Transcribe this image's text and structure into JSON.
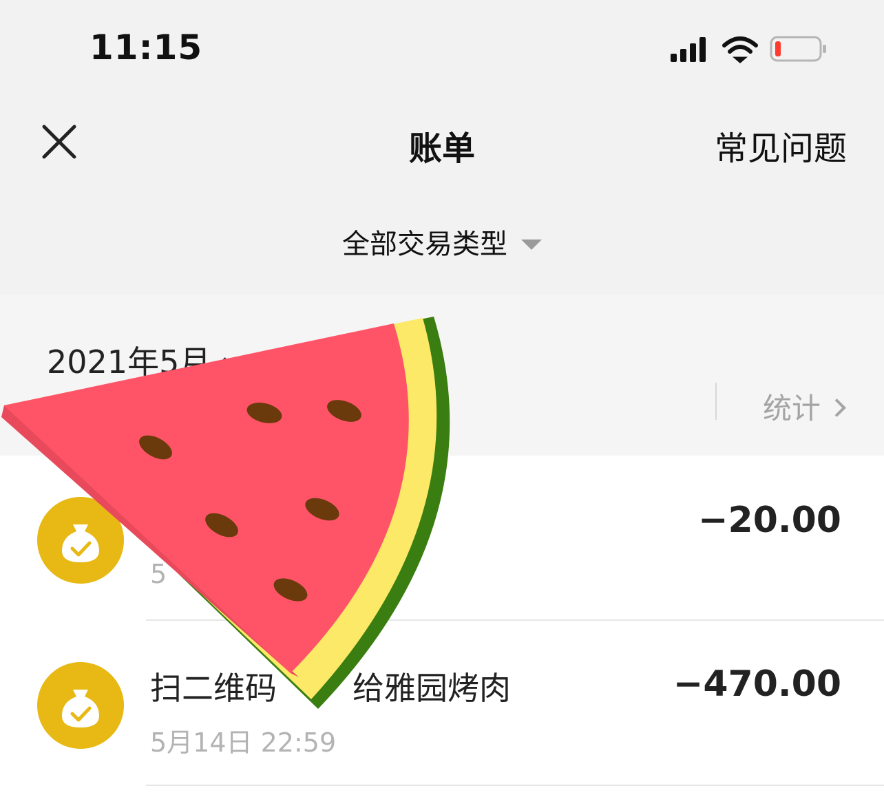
{
  "status_bar": {
    "time": "11:15",
    "battery_level": 0.1
  },
  "nav": {
    "title": "账单",
    "faq_label": "常见问题",
    "close_icon": "close-icon"
  },
  "filter": {
    "label": "全部交易类型"
  },
  "month_section": {
    "month_label": "2021年5月",
    "stats_label": "统计"
  },
  "transactions": [
    {
      "title": "",
      "time": "5",
      "amount": "−20.00",
      "icon": "money-bag-icon"
    },
    {
      "title": "扫二维码",
      "title_tail": "给雅园烤肉",
      "time": "5月14日 22:59",
      "amount": "−470.00",
      "icon": "money-bag-icon"
    }
  ],
  "colors": {
    "header_bg": "#f2f2f2",
    "icon_yellow": "#e8b914",
    "watermelon_flesh": "#ff5468",
    "watermelon_rind_inner": "#fce967",
    "watermelon_rind_outer": "#3a7d10"
  },
  "sticker": "watermelon-sticker"
}
